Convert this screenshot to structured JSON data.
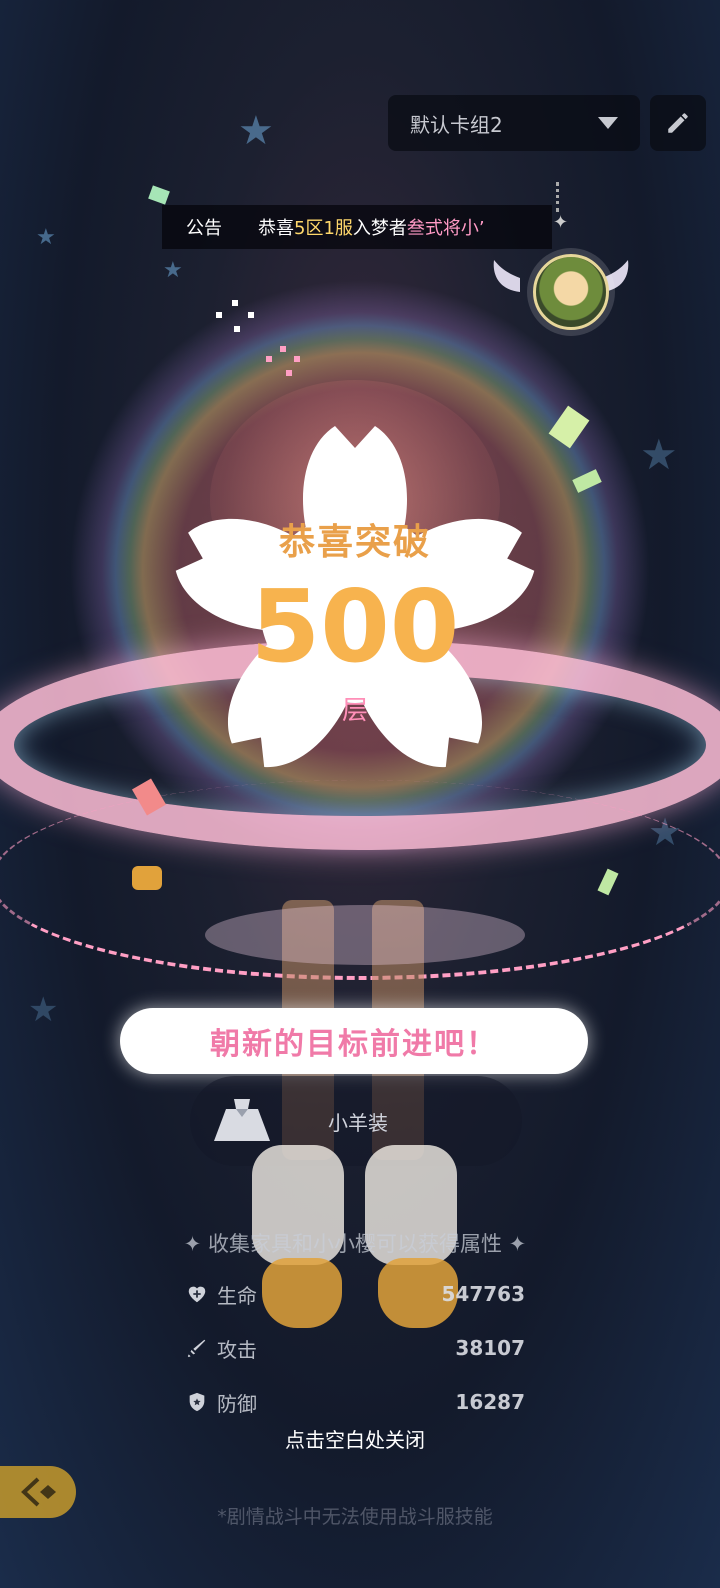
{
  "header": {
    "deck_name": "默认卡组2",
    "edit_icon": "pencil-icon"
  },
  "announcement": {
    "label": "公告",
    "prefix": "恭喜",
    "zone": "5区",
    "server": "1服",
    "middle": "入梦者",
    "player": "叁式",
    "suffix": "将小’"
  },
  "achievement": {
    "title": "恭喜突破",
    "floor": "500",
    "unit": "层",
    "slogan": "朝新的目标前进吧！"
  },
  "costume": {
    "icon": "dress-icon",
    "name": "小羊装"
  },
  "stats": {
    "title": "✦ 收集家具和小小樱可以获得属性 ✦",
    "rows": [
      {
        "icon": "heart-plus-icon",
        "label": "生命",
        "value": "547763"
      },
      {
        "icon": "sword-icon",
        "label": "攻击",
        "value": "38107"
      },
      {
        "icon": "shield-icon",
        "label": "防御",
        "value": "16287"
      }
    ]
  },
  "close_hint": "点击空白处关闭",
  "note": "*剧情战斗中无法使用战斗服技能",
  "colors": {
    "accent_orange": "#f7b34e",
    "accent_pink": "#f07aa8",
    "back_button": "#c59a2c"
  }
}
